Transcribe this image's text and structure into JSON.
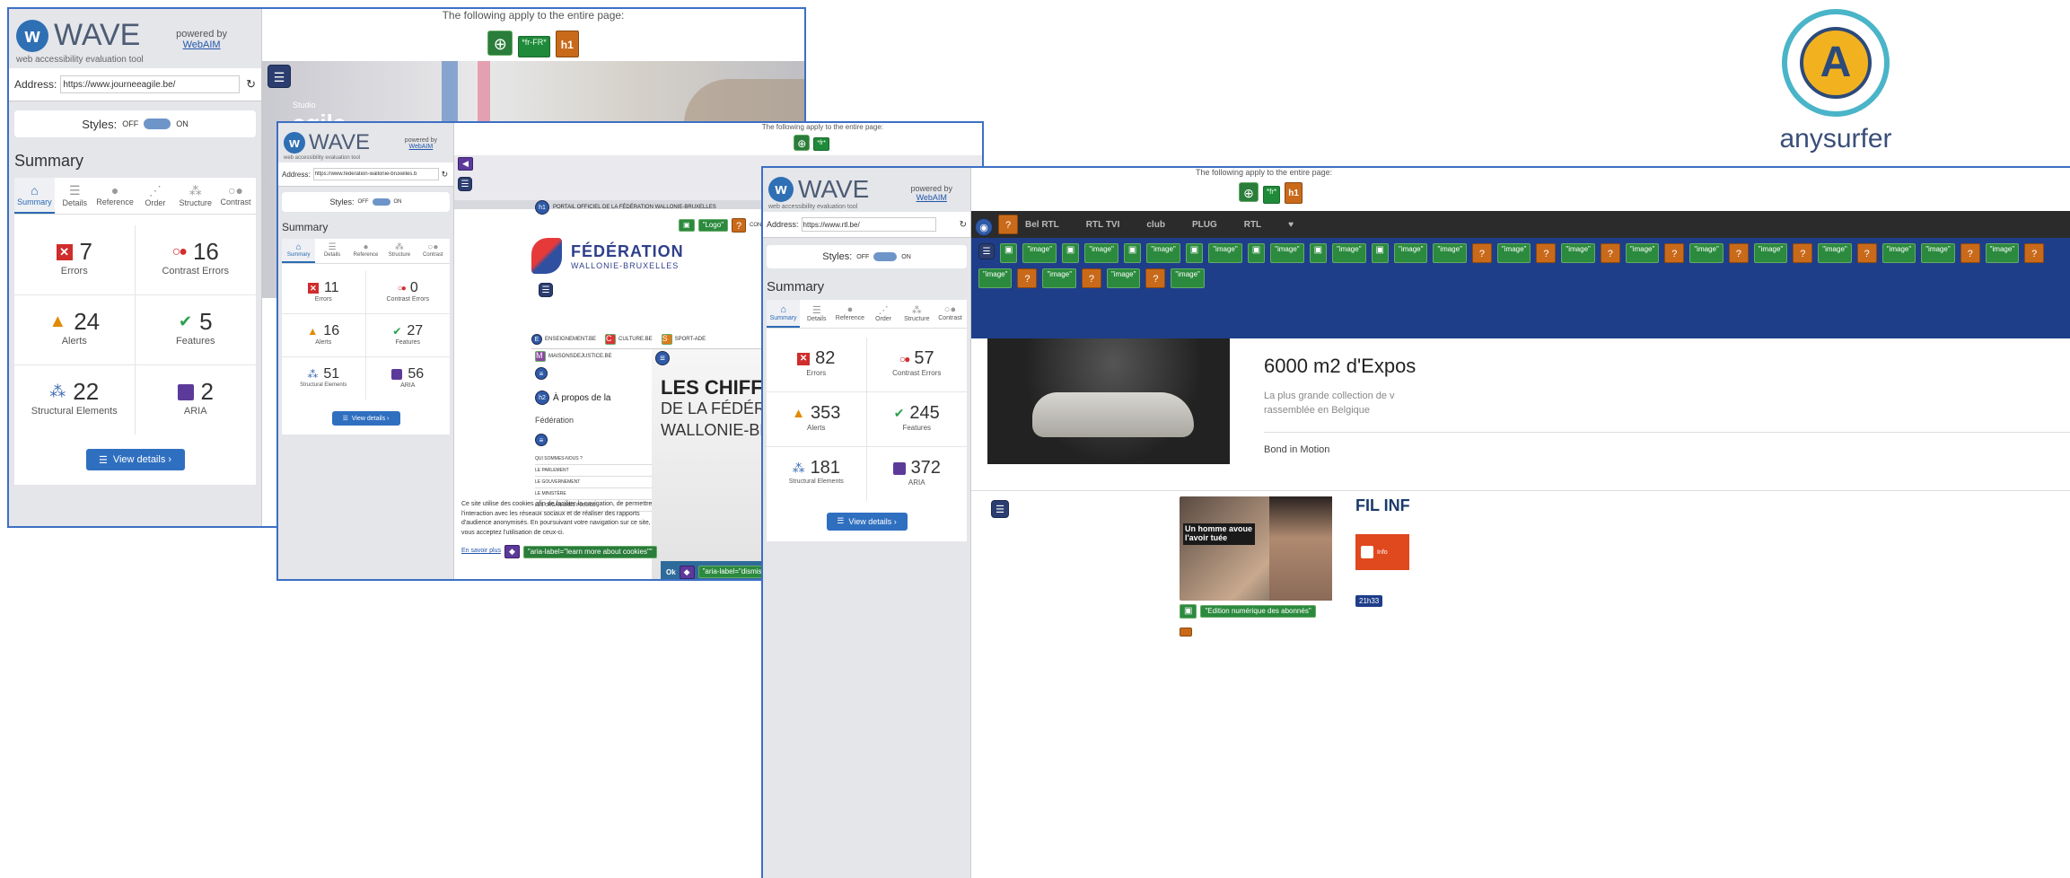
{
  "wave_common": {
    "logo": "WAVE",
    "subtitle": "web accessibility evaluation tool",
    "powered_by": "powered by",
    "webaim": "WebAIM",
    "address_label": "Address:",
    "styles_label": "Styles:",
    "styles_off": "OFF",
    "styles_on": "ON",
    "summary_title": "Summary",
    "view_details": "View details ›",
    "labels": {
      "errors": "Errors",
      "contrast": "Contrast Errors",
      "alerts": "Alerts",
      "features": "Features",
      "structural": "Structural Elements",
      "aria": "ARIA"
    },
    "applies": "The following apply to the entire page:"
  },
  "shot1": {
    "url": "https://www.journeeagile.be/",
    "tabs": [
      "Summary",
      "Details",
      "Reference",
      "Order",
      "Structure",
      "Contrast"
    ],
    "errors": "7",
    "contrast": "16",
    "alerts": "24",
    "features": "5",
    "structural": "22",
    "aria": "2",
    "lang": "*fr-FR*",
    "brand": "agile",
    "brand_small": "Studio"
  },
  "shot2": {
    "url": "https://www.federation-wallonie-bruxelles.b",
    "tabs": [
      "Summary",
      "Details",
      "Reference",
      "Structure",
      "Contrast"
    ],
    "errors": "11",
    "contrast": "0",
    "alerts": "16",
    "features": "27",
    "structural": "51",
    "aria": "56",
    "lang": "*fr*",
    "portal": "PORTAIL OFFICIEL DE LA FÉDÉRATION WALLONIE-BRUXELLES",
    "logo_badge": "\"Logo\"",
    "contact": "CONTAC",
    "fed_name": "FÉDÉRATION",
    "fed_sub": "WALLONIE-BRUXELLES",
    "nav": [
      "ENSEIGNEMENT.BE",
      "CULTURE.BE",
      "SPORT-ADE"
    ],
    "nav2": "MAISONSDEJUSTICE.BE",
    "about": "À propos de la",
    "about2": "Fédération",
    "menu": [
      "QUI SOMMES-NOUS ?",
      "LE PARLEMENT",
      "LE GOUVERNEMENT",
      "LE MINISTÈRE",
      "LES ORGANISMES PUBLICS"
    ],
    "hero1": "LES CHIFFRE",
    "hero2": "DE LA FÉDÉRAT",
    "hero3": "WALLONIE-BRU",
    "cookie": "Ce site utilise des cookies afin de faciliter la navigation, de permettre l'interaction avec les réseaux sociaux et de réaliser des rapports d'audience anonymisés. En poursuivant votre navigation sur ce site, vous acceptez l'utilisation de ceux-ci.",
    "learn": "En savoir plus",
    "aria_label": "\"aria-label=\"learn more about cookies\"\"",
    "ok": "Ok",
    "aria_label2": "\"aria-label=\"dismiss c"
  },
  "shot3": {
    "url": "https://www.rtl.be/",
    "tabs": [
      "Summary",
      "Details",
      "Reference",
      "Order",
      "Structure",
      "Contrast"
    ],
    "errors": "82",
    "contrast": "57",
    "alerts": "353",
    "features": "245",
    "structural": "181",
    "aria": "372",
    "lang": "*fr*",
    "brands": [
      "Bel RTL",
      "RTL TVI",
      "club",
      "PLUG",
      "RTL"
    ],
    "image_label": "\"image\"",
    "headline": "6000 m2 d'Expos",
    "desc1": "La plus grande collection de v",
    "desc2": "rassemblée en Belgique",
    "bond": "Bond in Motion",
    "video_title": "Un homme avoue l'avoir tuée",
    "edition": "\"Edition numérique des abonnés\"",
    "fil": "FIL INF",
    "info": "Info",
    "time": "21h33"
  },
  "anysurfer": {
    "letter": "A",
    "name": "anysurfer"
  }
}
